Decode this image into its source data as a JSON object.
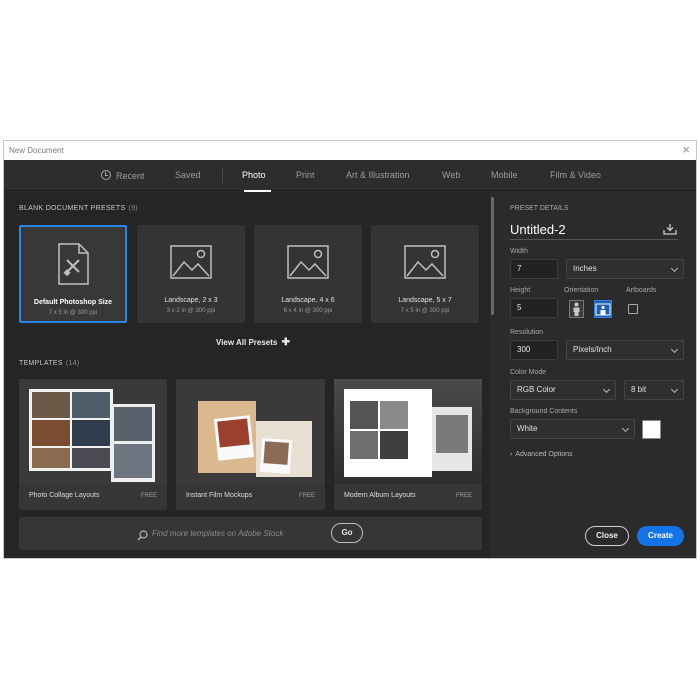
{
  "window": {
    "title": "New Document"
  },
  "tabs": [
    {
      "label": "Recent"
    },
    {
      "label": "Saved"
    },
    {
      "label": "Photo",
      "active": true
    },
    {
      "label": "Print"
    },
    {
      "label": "Art & Illustration"
    },
    {
      "label": "Web"
    },
    {
      "label": "Mobile"
    },
    {
      "label": "Film & Video"
    }
  ],
  "presets": {
    "title": "BLANK DOCUMENT PRESETS",
    "count": "(9)",
    "items": [
      {
        "name": "Default Photoshop Size",
        "size": "7 x 5 in @ 300 ppi",
        "icon": "document-icon",
        "selected": true
      },
      {
        "name": "Landscape, 2 x 3",
        "size": "3 x 2 in @ 300 ppi",
        "icon": "image-icon"
      },
      {
        "name": "Landscape, 4 x 6",
        "size": "6 x 4 in @ 300 ppi",
        "icon": "image-icon"
      },
      {
        "name": "Landscape, 5 x 7",
        "size": "7 x 5 in @ 300 ppi",
        "icon": "image-icon"
      }
    ],
    "view_all": "View All Presets"
  },
  "templates": {
    "title": "TEMPLATES",
    "count": "(14)",
    "items": [
      {
        "name": "Photo Collage Layouts",
        "badge": "FREE"
      },
      {
        "name": "Instant Film Mockups",
        "badge": "FREE"
      },
      {
        "name": "Modern Album Layouts",
        "badge": "FREE"
      }
    ],
    "search_placeholder": "Find more templates on Adobe Stock",
    "go_label": "Go"
  },
  "preset_details": {
    "title": "PRESET DETAILS",
    "doc_name": "Untitled-2",
    "width_label": "Width",
    "width_value": "7",
    "width_unit": "Inches",
    "height_label": "Height",
    "height_value": "5",
    "orientation_label": "Orientation",
    "artboards_label": "Artboards",
    "artboards_checked": false,
    "resolution_label": "Resolution",
    "resolution_value": "300",
    "resolution_unit": "Pixels/Inch",
    "color_mode_label": "Color Mode",
    "color_mode": "RGB Color",
    "bit_depth": "8 bit",
    "background_label": "Background Contents",
    "background_value": "White",
    "background_color": "#ffffff",
    "advanced_label": "Advanced Options",
    "close_label": "Close",
    "create_label": "Create"
  },
  "colors": {
    "accent": "#1473e6",
    "selected_border": "#2d85e5"
  }
}
